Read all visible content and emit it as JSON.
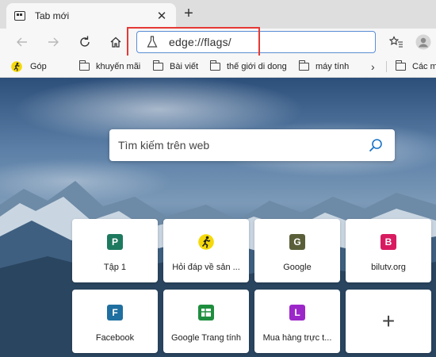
{
  "tab": {
    "title": "Tab mới",
    "close": "✕",
    "new_tab": "+"
  },
  "toolbar": {
    "back_icon": "arrow-left-icon",
    "forward_icon": "arrow-right-icon",
    "refresh_icon": "refresh-icon",
    "home_icon": "home-icon",
    "address": "edge://flags/",
    "favorites_icon": "star-list-icon",
    "profile_icon": "profile-avatar-icon"
  },
  "favorites": {
    "items": [
      {
        "label": "Góp",
        "icon": "runner-icon"
      },
      {
        "label": "khuyến mãi",
        "icon": "folder-icon"
      },
      {
        "label": "Bài viết",
        "icon": "folder-icon"
      },
      {
        "label": "thế giới di dong",
        "icon": "folder-icon"
      },
      {
        "label": "máy tính",
        "icon": "folder-icon"
      }
    ],
    "more": "›",
    "other_label": "Các m"
  },
  "search": {
    "placeholder": "Tìm kiếm trên web"
  },
  "tiles": [
    {
      "label": "Tập 1",
      "letter": "P",
      "color": "#1e7a5f"
    },
    {
      "label": "Hỏi đáp về sản ...",
      "letter": "",
      "color": "#f5d90a",
      "icon": "runner-icon"
    },
    {
      "label": "Google",
      "letter": "G",
      "color": "#5a5f3a"
    },
    {
      "label": "bilutv.org",
      "letter": "B",
      "color": "#d81b60"
    },
    {
      "label": "Facebook",
      "letter": "F",
      "color": "#1f6fa0"
    },
    {
      "label": "Google Trang tính",
      "letter": "",
      "color": "#1e8e3e",
      "icon": "sheets-icon"
    },
    {
      "label": "Mua hàng trực t...",
      "letter": "L",
      "color": "#9c27c9"
    },
    {
      "label": "",
      "letter": "+",
      "color": "#ffffff",
      "icon": "plus-icon"
    }
  ]
}
